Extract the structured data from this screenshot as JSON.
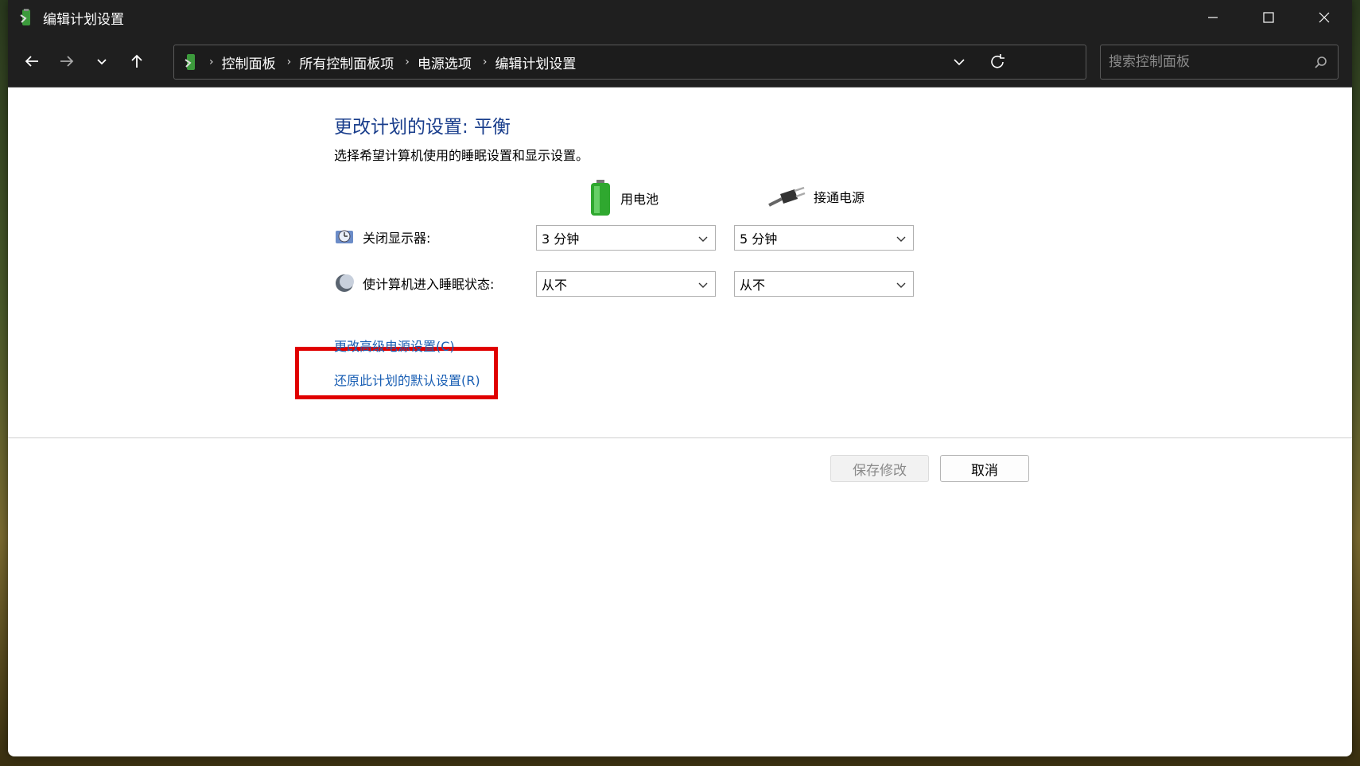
{
  "window": {
    "title": "编辑计划设置"
  },
  "nav": {
    "breadcrumbs": [
      "控制面板",
      "所有控制面板项",
      "电源选项",
      "编辑计划设置"
    ],
    "search_placeholder": "搜索控制面板"
  },
  "main": {
    "heading": "更改计划的设置: 平衡",
    "subtitle": "选择希望计算机使用的睡眠设置和显示设置。",
    "col_battery": "用电池",
    "col_ac": "接通电源",
    "rows": [
      {
        "label": "关闭显示器:",
        "battery": "3 分钟",
        "ac": "5 分钟"
      },
      {
        "label": "使计算机进入睡眠状态:",
        "battery": "从不",
        "ac": "从不"
      }
    ],
    "link_advanced": "更改高级电源设置(C)",
    "link_restore": "还原此计划的默认设置(R)",
    "save_label": "保存修改",
    "cancel_label": "取消"
  },
  "colors": {
    "heading": "#1a3e8c",
    "link": "#1a5fb4",
    "highlight": "#e00000",
    "titlebar": "#1f1f1f"
  }
}
